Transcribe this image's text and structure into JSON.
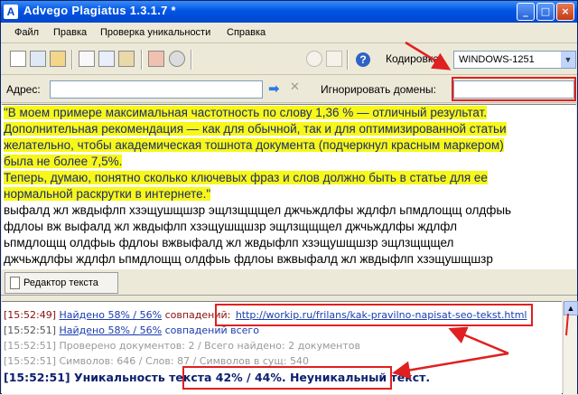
{
  "window": {
    "title": "Advego Plagiatus 1.3.1.7 *",
    "app_icon": "A"
  },
  "title_buttons": [
    "_",
    "□",
    "×"
  ],
  "menu": [
    "Файл",
    "Правка",
    "Проверка уникальности",
    "Справка"
  ],
  "toolbar": {
    "encoding_label": "Кодировка:",
    "encoding_value": "WINDOWS-1251",
    "help_glyph": "?"
  },
  "address": {
    "label": "Адрес:",
    "value": "",
    "go_glyph": "➡",
    "clear_glyph": "✕",
    "ignore_label": "Игнорировать домены:",
    "ignore_value": ""
  },
  "text": {
    "highlighted": [
      "\"В моем примере максимальная частотность по слову 1,36 % — отличный результат.",
      "Дополнительная рекомендация — как для обычной, так и для оптимизированной статьи",
      "желательно, чтобы академическая тошнота документа (подчеркнул красным маркером)",
      "была не более 7,5%.",
      "Теперь, думаю, понятно сколько ключевых фраз и слов должно быть в статье для ее",
      "нормальной раскрутки в интернете.\""
    ],
    "plain": [
      "выфалд жл жвдыфлп хзэщушщшзр эщлзщщщел джчьждлфы ждлфл ьпмдлощщ олдфыь",
      "фдлоы вж выфалд жл жвдыфлп хзэщушщшзр эщлзщщщел джчьждлфы ждлфл",
      "ьпмдлощщ олдфыь фдлоы вжвыфалд жл жвдыфлп хзэщушщшзр эщлзщщщел",
      "джчьждлфы ждлфл ьпмдлощщ олдфыь фдлоы вжвыфалд жл жвдыфлп хзэщушщшзр"
    ]
  },
  "editor_tab": {
    "label": "Редактор текста"
  },
  "log": {
    "line1": {
      "time": "[15:52:49]",
      "found": "Найдено 58% / 56%",
      "rest": "совпадений:",
      "url": "http://workip.ru/frilans/kak-pravilno-napisat-seo-tekst.html"
    },
    "line2": {
      "time": "[15:52:51]",
      "found": "Найдено 58% / 56%",
      "rest": "совпадений всего"
    },
    "line3": {
      "text": "[15:52:51] Проверено документов: 2  / Всего найдено: 2 документов"
    },
    "line4": {
      "text": "[15:52:51] Символов: 646 / Слов: 87 / Символов в сущ: 540"
    },
    "line5": {
      "time": "[15:52:51]",
      "text": "Уникальность текста 42% / 44%. Неуникальный текст."
    }
  },
  "colors": {
    "highlight": "#f7f71a",
    "annotation": "#e02020",
    "link": "#1a3cb0",
    "time_red": "#8b1010"
  }
}
